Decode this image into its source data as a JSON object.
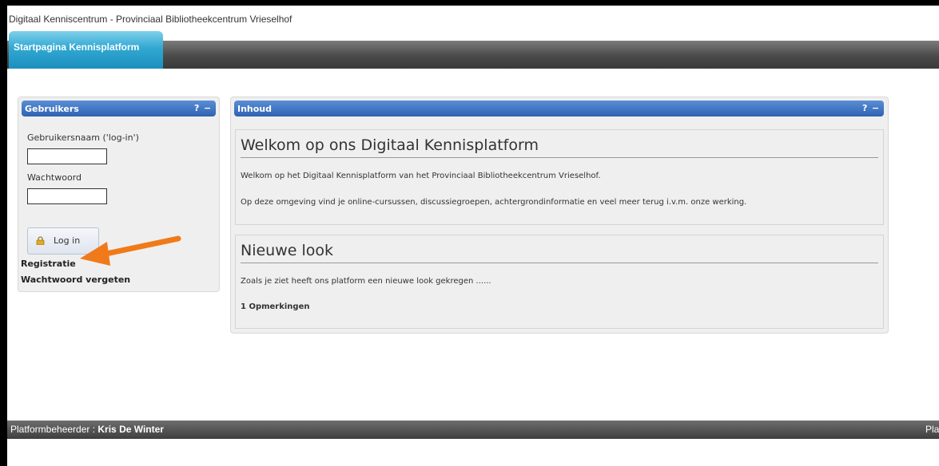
{
  "header": {
    "site_title": "Digitaal Kenniscentrum - Provinciaal Bibliotheekcentrum Vrieselhof"
  },
  "nav": {
    "tabs": [
      {
        "label": "Startpagina Kennisplatform",
        "active": true
      }
    ]
  },
  "users_panel": {
    "title": "Gebruikers",
    "help": "?",
    "collapse": "−",
    "username_label": "Gebruikersnaam ('log-in')",
    "username_value": "",
    "password_label": "Wachtwoord",
    "password_value": "",
    "login_button": "Log in",
    "register_link": "Registratie",
    "forgot_link": "Wachtwoord vergeten"
  },
  "content_panel": {
    "title": "Inhoud",
    "help": "?",
    "collapse": "−",
    "articles": [
      {
        "title": "Welkom op ons Digitaal Kennisplatform",
        "paragraphs": [
          "Welkom op het Digitaal Kennisplatform van het Provinciaal Bibliotheekcentrum Vrieselhof.",
          "Op deze omgeving vind je online-cursussen, discussiegroepen, achtergrondinformatie en veel meer terug i.v.m. onze werking."
        ]
      },
      {
        "title": "Nieuwe look",
        "paragraphs": [
          "Zoals je ziet heeft ons platform een nieuwe look gekregen ......"
        ],
        "comments": "1 Opmerkingen"
      }
    ]
  },
  "footer": {
    "admin_label": "Platformbeheerder : ",
    "admin_name": "Kris De Winter",
    "right_text": "Plat"
  },
  "colors": {
    "panel_header": "#2e63b3",
    "active_tab": "#31a8d2",
    "navbar": "#4a4a4a",
    "annotation_arrow": "#f07a1a"
  },
  "annotation": {
    "icon": "orange-arrow-icon"
  }
}
